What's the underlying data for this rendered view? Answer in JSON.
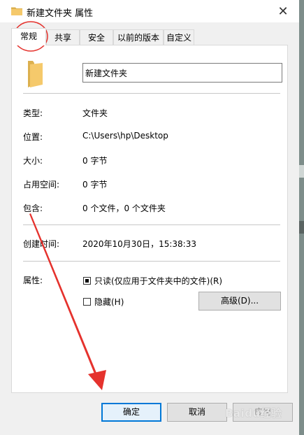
{
  "window": {
    "title": "新建文件夹 属性"
  },
  "tabs": [
    {
      "label": "常规",
      "active": true
    },
    {
      "label": "共享"
    },
    {
      "label": "安全"
    },
    {
      "label": "以前的版本"
    },
    {
      "label": "自定义"
    }
  ],
  "general": {
    "folder_name": "新建文件夹",
    "rows": [
      {
        "label": "类型:",
        "value": "文件夹"
      },
      {
        "label": "位置:",
        "value": "C:\\Users\\hp\\Desktop"
      },
      {
        "label": "大小:",
        "value": "0 字节"
      },
      {
        "label": "占用空间:",
        "value": "0 字节"
      },
      {
        "label": "包含:",
        "value": "0 个文件，0 个文件夹"
      },
      {
        "label": "创建时间:",
        "value": "2020年10月30日，15:38:33"
      }
    ],
    "attributes_label": "属性:",
    "readonly_label": "只读(仅应用于文件夹中的文件)(R)",
    "readonly_state": "indeterminate",
    "hidden_label": "隐藏(H)",
    "hidden_checked": false,
    "advanced_button": "高级(D)..."
  },
  "buttons": {
    "ok": "确定",
    "cancel": "取消",
    "apply": "应用"
  },
  "colors": {
    "folder": "#f5c96b",
    "annotation": "#e5322d",
    "focus": "#0078d7"
  },
  "watermark": "Baidu经验"
}
